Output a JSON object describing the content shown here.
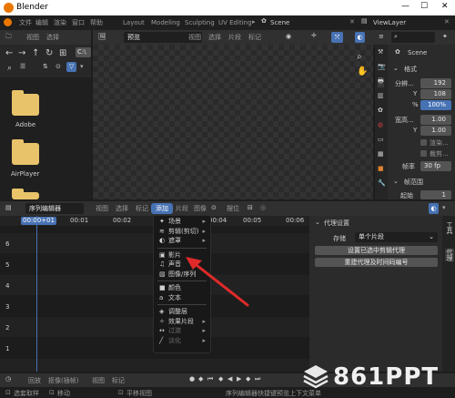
{
  "titlebar": {
    "app_title": "Blender",
    "minimize": "—",
    "maximize": "☐",
    "close": "✕"
  },
  "menubar": {
    "items": [
      "文件",
      "编辑",
      "渲染",
      "窗口",
      "帮助"
    ],
    "workspaces": [
      "Layout",
      "Modeling",
      "Sculpting",
      "UV Editing"
    ],
    "scene": "Scene",
    "view_layer": "ViewLayer"
  },
  "file_browser": {
    "header_items": [
      "视图",
      "选择"
    ],
    "path_hint": "C:\\",
    "folders": [
      "Adobe",
      "AirPlayer",
      ""
    ]
  },
  "image_editor": {
    "header_items": [
      "视图",
      "选择",
      "片段",
      "标记"
    ],
    "mode": "预览"
  },
  "properties": {
    "scene_label": "Scene",
    "format_section": "格式",
    "resolution_label": "分辨...",
    "res_x": "192",
    "y_label": "Y",
    "res_y": "108",
    "percent_label": "%",
    "res_percent": "100%",
    "aspect_label": "宽高...",
    "aspect_x": "1.00",
    "aspect_y": "1.00",
    "border_label": "渲染...",
    "crop_label": "裁剪...",
    "fps_label": "帧率",
    "fps_value": "30 fp",
    "frame_range_section": "帧范围",
    "frame_start_label": "起始",
    "frame_start": "1"
  },
  "sequencer": {
    "editor_type": "序列编辑器",
    "header_items": [
      "视图",
      "选择",
      "标记",
      "添加",
      "片段",
      "图像"
    ],
    "snap_label": "摆位",
    "timecodes": [
      "00:00+01",
      "00:01",
      "00:02",
      "00:04",
      "00:05",
      "00:06"
    ],
    "channels": [
      "6",
      "5",
      "4",
      "3",
      "2",
      "1"
    ]
  },
  "add_menu": {
    "items": [
      {
        "icon": "✦",
        "label": "场景",
        "submenu": true,
        "state": "normal"
      },
      {
        "icon": "≋",
        "label": "剪辑(剪切)",
        "submenu": true,
        "state": "normal"
      },
      {
        "icon": "◐",
        "label": "遮罩",
        "submenu": true,
        "state": "normal"
      },
      {
        "sep": true
      },
      {
        "icon": "▣",
        "label": "影片",
        "submenu": false,
        "state": "normal"
      },
      {
        "icon": "♫",
        "label": "声音",
        "submenu": false,
        "state": "normal"
      },
      {
        "icon": "▨",
        "label": "图像/序列",
        "submenu": false,
        "state": "normal"
      },
      {
        "sep": true
      },
      {
        "icon": "■",
        "label": "颜色",
        "submenu": false,
        "state": "normal"
      },
      {
        "icon": "a",
        "label": "文本",
        "submenu": false,
        "state": "normal"
      },
      {
        "sep": true
      },
      {
        "icon": "◈",
        "label": "调整层",
        "submenu": false,
        "state": "normal"
      },
      {
        "icon": "✧",
        "label": "效果片段",
        "submenu": true,
        "state": "normal"
      },
      {
        "icon": "↔",
        "label": "过渡",
        "submenu": true,
        "state": "dim"
      },
      {
        "icon": "╱",
        "label": "淡化",
        "submenu": true,
        "state": "dim"
      }
    ]
  },
  "proxy_panel": {
    "title": "代理设置",
    "storage_label": "存储",
    "storage_value": "单个片段",
    "set_button": "设置已选中剪辑代理",
    "rebuild_button": "重建代理及时间码编号",
    "side_tabs": [
      "工具",
      "代理"
    ]
  },
  "timeline": {
    "header_items": [
      "回放",
      "抠像(插帧)",
      "视图",
      "标记"
    ]
  },
  "statusbar": {
    "items": [
      "选套取样",
      "移动",
      "平移视图",
      "序列编辑器快捷键预览上下文菜单"
    ]
  },
  "watermark": {
    "text": "861PPT"
  },
  "colors": {
    "accent": "#4772b3",
    "playhead": "#4772b3",
    "arrow": "#e02a2a",
    "folder": "#e8c36a"
  }
}
